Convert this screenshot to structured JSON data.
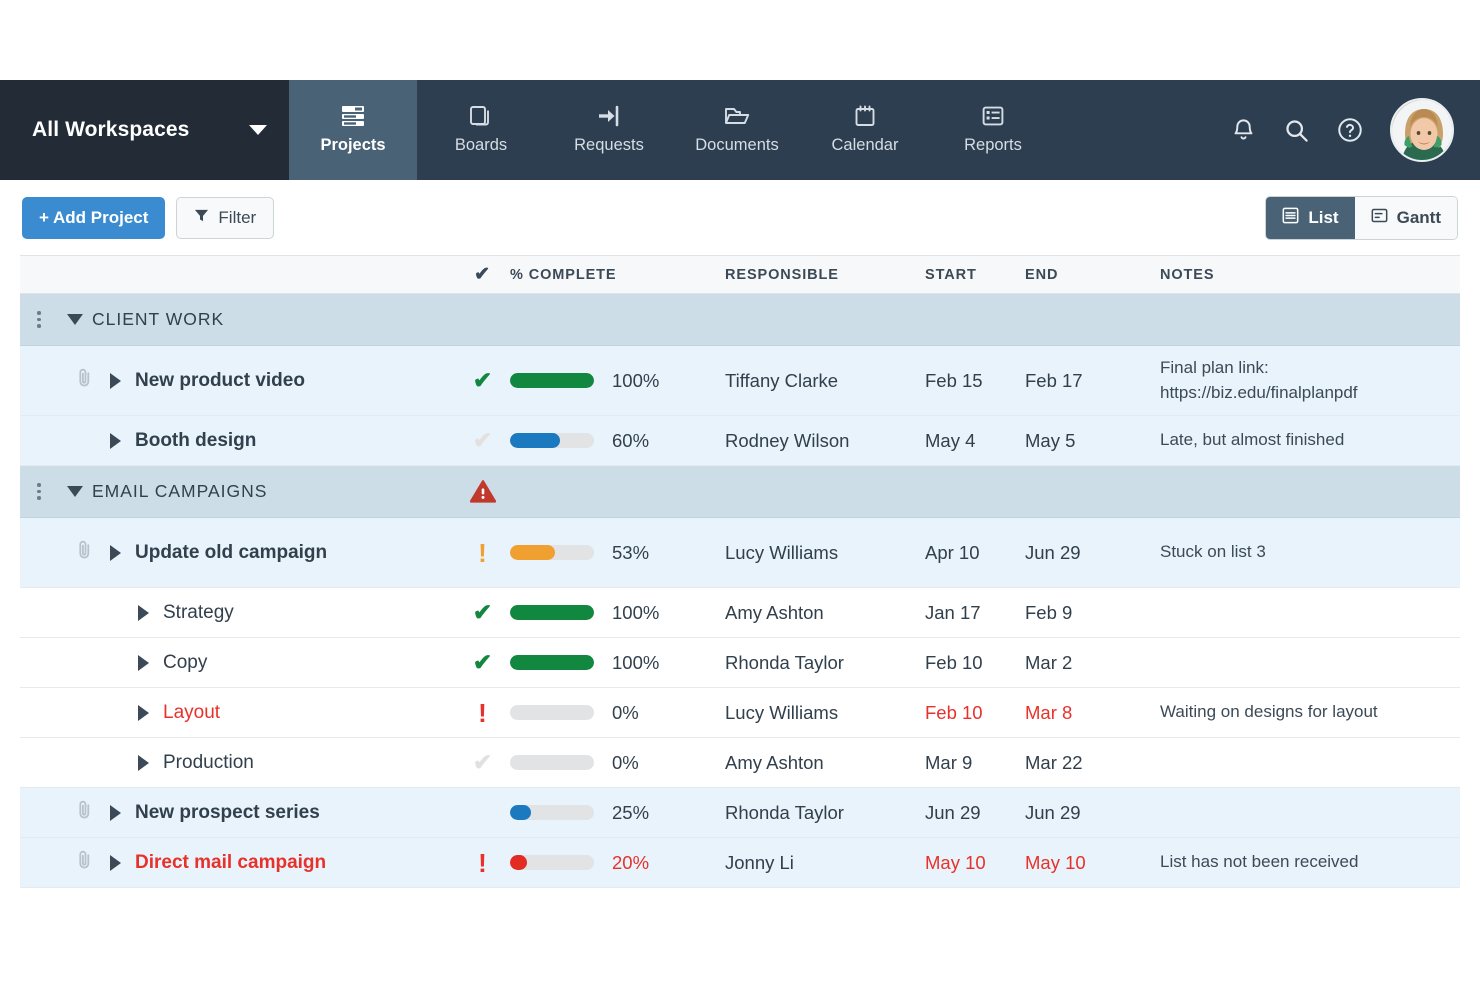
{
  "navbar": {
    "workspace_label": "All Workspaces",
    "workspace_caret_icon": "chevron-down-icon",
    "items": [
      {
        "label": "Projects",
        "icon": "projects-icon",
        "active": true
      },
      {
        "label": "Boards",
        "icon": "boards-icon",
        "active": false
      },
      {
        "label": "Requests",
        "icon": "requests-icon",
        "active": false
      },
      {
        "label": "Documents",
        "icon": "documents-icon",
        "active": false
      },
      {
        "label": "Calendar",
        "icon": "calendar-icon",
        "active": false
      },
      {
        "label": "Reports",
        "icon": "reports-icon",
        "active": false
      }
    ],
    "right_icons": [
      "bell-icon",
      "search-icon",
      "help-icon"
    ],
    "avatar_alt": "user-avatar"
  },
  "toolbar": {
    "add_project_label": "+ Add Project",
    "filter_label": "Filter",
    "filter_icon": "funnel-icon",
    "views": [
      {
        "label": "List",
        "icon": "list-view-icon",
        "active": true
      },
      {
        "label": "Gantt",
        "icon": "gantt-view-icon",
        "active": false
      }
    ]
  },
  "table": {
    "columns": {
      "check": "✔",
      "complete": "% COMPLETE",
      "responsible": "RESPONSIBLE",
      "start": "START",
      "end": "END",
      "notes": "NOTES"
    },
    "rows": [
      {
        "kind": "group",
        "title": "CLIENT WORK",
        "flag": "none",
        "handle": true,
        "expanded": true
      },
      {
        "kind": "task",
        "indent": 0,
        "title": "New product video",
        "title_style": "bold",
        "attachment": true,
        "flag": "check-done",
        "percent": "100%",
        "percent_value": 100,
        "bar_color": "#12873f",
        "responsible": "Tiffany Clarke",
        "start": "Feb 15",
        "end": "Feb 17",
        "notes": "Final plan link:\nhttps://biz.edu/finalplanpdf",
        "shade": "shade",
        "tall": true,
        "date_style": "normal"
      },
      {
        "kind": "task",
        "indent": 0,
        "title": "Booth design",
        "title_style": "bold",
        "attachment": false,
        "flag": "check-off",
        "percent": "60%",
        "percent_value": 60,
        "bar_color": "#1b79bf",
        "responsible": "Rodney Wilson",
        "start": "May 4",
        "end": "May 5",
        "notes": "Late, but almost finished",
        "shade": "shade",
        "tall": false,
        "date_style": "normal"
      },
      {
        "kind": "group",
        "title": "EMAIL CAMPAIGNS",
        "flag": "warning-triangle",
        "handle": true,
        "expanded": true
      },
      {
        "kind": "task",
        "indent": 0,
        "title": "Update old campaign",
        "title_style": "bold",
        "attachment": true,
        "flag": "bang-orange",
        "percent": "53%",
        "percent_value": 53,
        "bar_color": "#f0a030",
        "responsible": "Lucy Williams",
        "start": "Apr 10",
        "end": "Jun 29",
        "notes": "Stuck on list 3",
        "shade": "shade",
        "tall": true,
        "date_style": "normal"
      },
      {
        "kind": "task",
        "indent": 1,
        "title": "Strategy",
        "title_style": "normal",
        "attachment": false,
        "flag": "check-done",
        "percent": "100%",
        "percent_value": 100,
        "bar_color": "#12873f",
        "responsible": "Amy Ashton",
        "start": "Jan 17",
        "end": "Feb 9",
        "notes": "",
        "shade": "plain",
        "tall": false,
        "date_style": "normal"
      },
      {
        "kind": "task",
        "indent": 1,
        "title": "Copy",
        "title_style": "normal",
        "attachment": false,
        "flag": "check-done",
        "percent": "100%",
        "percent_value": 100,
        "bar_color": "#12873f",
        "responsible": "Rhonda Taylor",
        "start": "Feb 10",
        "end": "Mar 2",
        "notes": "",
        "shade": "plain",
        "tall": false,
        "date_style": "normal"
      },
      {
        "kind": "task",
        "indent": 1,
        "title": "Layout",
        "title_style": "red",
        "attachment": false,
        "flag": "bang-red",
        "percent": "0%",
        "percent_value": 0,
        "bar_color": "#e1e3e5",
        "responsible": "Lucy Williams",
        "start": "Feb 10",
        "end": "Mar 8",
        "notes": "Waiting on designs for layout",
        "shade": "plain",
        "tall": false,
        "date_style": "red"
      },
      {
        "kind": "task",
        "indent": 1,
        "title": "Production",
        "title_style": "normal",
        "attachment": false,
        "flag": "check-off",
        "percent": "0%",
        "percent_value": 0,
        "bar_color": "#e1e3e5",
        "responsible": "Amy Ashton",
        "start": "Mar 9",
        "end": "Mar 22",
        "notes": "",
        "shade": "plain",
        "tall": false,
        "date_style": "normal"
      },
      {
        "kind": "task",
        "indent": 0,
        "title": "New prospect series",
        "title_style": "bold",
        "attachment": true,
        "flag": "none",
        "percent": "25%",
        "percent_value": 25,
        "bar_color": "#1b79bf",
        "responsible": "Rhonda Taylor",
        "start": "Jun 29",
        "end": "Jun 29",
        "notes": "",
        "shade": "shade",
        "tall": false,
        "date_style": "normal"
      },
      {
        "kind": "task",
        "indent": 0,
        "title": "Direct mail campaign",
        "title_style": "redbold",
        "attachment": true,
        "flag": "bang-red",
        "percent": "20%",
        "percent_value": 20,
        "bar_color": "#e22b22",
        "responsible": "Jonny Li",
        "start": "May 10",
        "end": "May 10",
        "notes": "List has not been received",
        "shade": "shade",
        "tall": false,
        "date_style": "red",
        "percent_style": "red"
      }
    ]
  },
  "colors": {
    "nav_bg": "#2c3e50",
    "nav_dark": "#222b36",
    "nav_active": "#4a6276",
    "accent_blue": "#3b8bd0",
    "green": "#12873f",
    "orange": "#f0a030",
    "red": "#e8312a",
    "group_bg": "#ccdde8",
    "row_shade": "#e8f3fb"
  }
}
